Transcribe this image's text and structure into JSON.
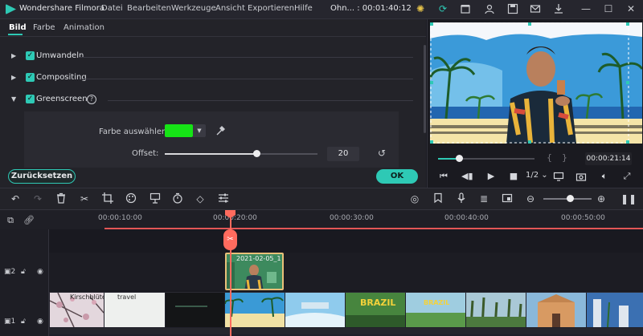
{
  "titlebar": {
    "app_title": "Wondershare Filmora",
    "menu": [
      "Datei",
      "Bearbeiten",
      "Werkzeuge",
      "Ansicht",
      "Exportieren",
      "Hilfe"
    ],
    "project_title": "Ohn... : 00:01:40:12"
  },
  "tabs": [
    "Bild",
    "Farbe",
    "Animation"
  ],
  "sections": {
    "transform": "Umwandeln",
    "compositing": "Compositing",
    "greenscreen": "Greenscreen"
  },
  "greenscreen": {
    "color_label": "Farbe auswählen:",
    "color_value": "#16e316",
    "offset_label": "Offset:",
    "offset_value": "20",
    "offset_fraction": 0.6
  },
  "buttons": {
    "reset": "Zurücksetzen",
    "ok": "OK"
  },
  "preview": {
    "time": "00:00:21:14",
    "ratio": "1/2",
    "progress_fraction": 0.22
  },
  "ruler": {
    "timecodes": [
      "00:00:10:00",
      "00:00:20:00",
      "00:00:30:00",
      "00:00:40:00",
      "00:00:50:00"
    ]
  },
  "tracks": {
    "track2_number": "2",
    "track1_number": "1",
    "pip_clip_label": "2021-02-05_14-3...",
    "main_clips": [
      "Kirschblüte",
      "travel",
      "",
      "",
      "",
      "",
      "BRAZIL",
      "BRAZIL",
      "",
      "",
      "",
      ""
    ]
  },
  "colors": {
    "accent": "#2ec9b5",
    "playhead": "#ff6b5e",
    "clip_border": "#e9c079"
  }
}
